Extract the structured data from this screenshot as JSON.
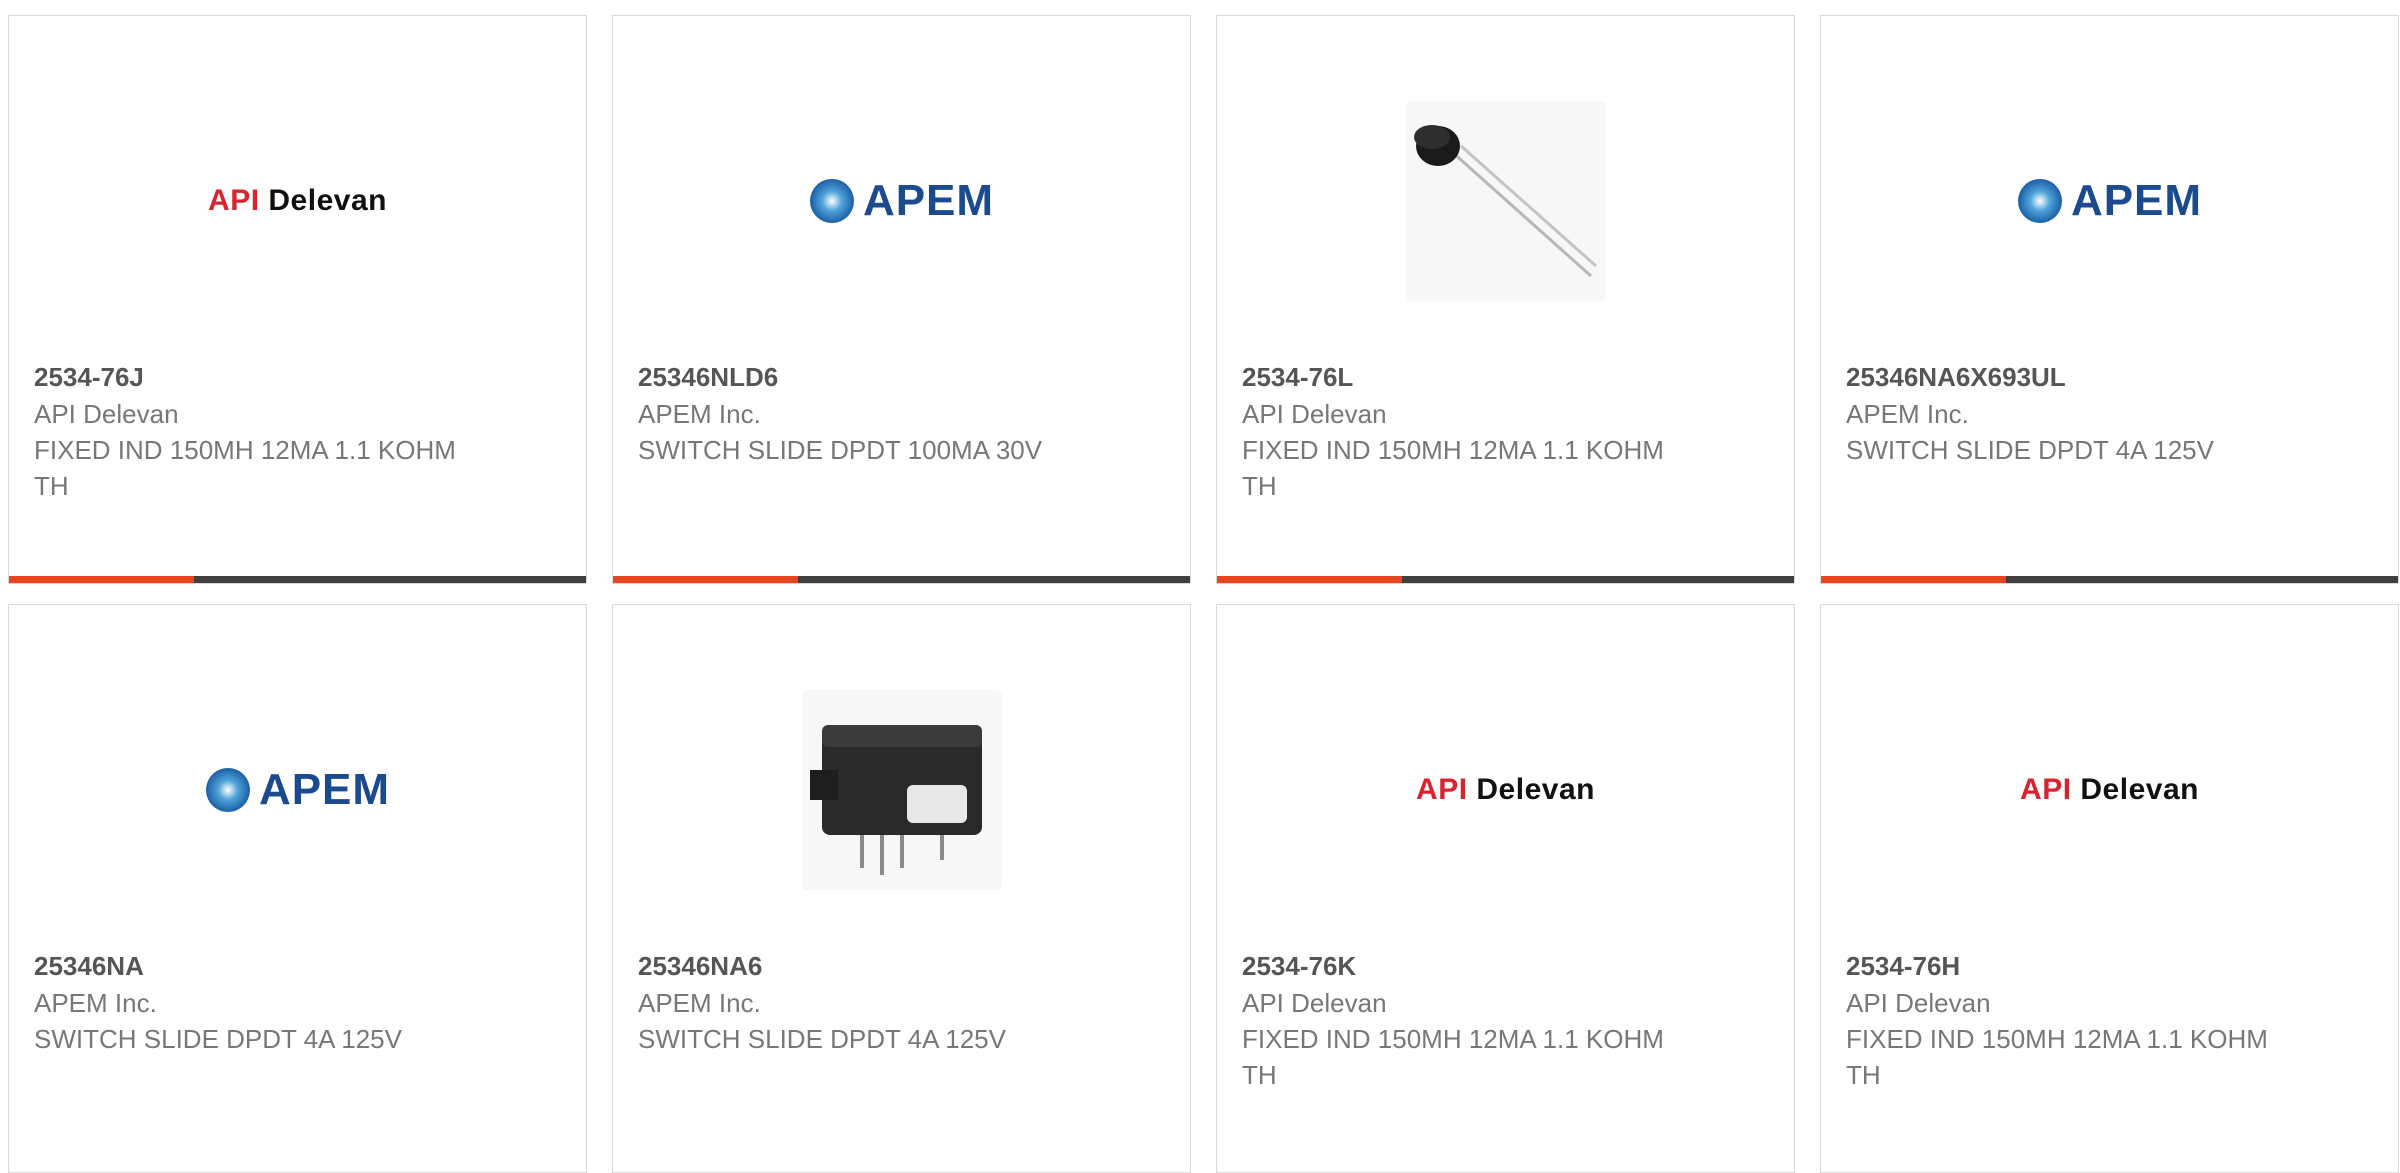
{
  "products": [
    {
      "part_number": "2534-76J",
      "manufacturer": "API Delevan",
      "description": "FIXED IND 150MH 12MA 1.1 KOHM TH",
      "image": "api-delevan-logo",
      "accent_progress": 0.32,
      "logo": {
        "part1": "API",
        "part2": "Delevan"
      }
    },
    {
      "part_number": "25346NLD6",
      "manufacturer": "APEM Inc.",
      "description": "SWITCH SLIDE DPDT 100MA 30V",
      "image": "apem-logo",
      "accent_progress": 0.32,
      "logo": {
        "text": "APEM"
      }
    },
    {
      "part_number": "2534-76L",
      "manufacturer": "API Delevan",
      "description": "FIXED IND 150MH 12MA 1.1 KOHM TH",
      "image": "inductor-photo",
      "accent_progress": 0.32
    },
    {
      "part_number": "25346NA6X693UL",
      "manufacturer": "APEM Inc.",
      "description": "SWITCH SLIDE DPDT 4A 125V",
      "image": "apem-logo",
      "accent_progress": 0.32,
      "logo": {
        "text": "APEM"
      }
    },
    {
      "part_number": "25346NA",
      "manufacturer": "APEM Inc.",
      "description": "SWITCH SLIDE DPDT 4A 125V",
      "image": "apem-logo",
      "logo": {
        "text": "APEM"
      }
    },
    {
      "part_number": "25346NA6",
      "manufacturer": "APEM Inc.",
      "description": "SWITCH SLIDE DPDT 4A 125V",
      "image": "slide-switch-photo"
    },
    {
      "part_number": "2534-76K",
      "manufacturer": "API Delevan",
      "description": "FIXED IND 150MH 12MA 1.1 KOHM TH",
      "image": "api-delevan-logo",
      "logo": {
        "part1": "API",
        "part2": "Delevan"
      }
    },
    {
      "part_number": "2534-76H",
      "manufacturer": "API Delevan",
      "description": "FIXED IND 150MH 12MA 1.1 KOHM TH",
      "image": "api-delevan-logo",
      "logo": {
        "part1": "API",
        "part2": "Delevan"
      }
    }
  ],
  "colors": {
    "accent": "#e8461e",
    "bar": "#3f3f3f",
    "border": "#d9d9d9",
    "api_red": "#d9232d",
    "apem_blue": "#1b4a8f"
  }
}
